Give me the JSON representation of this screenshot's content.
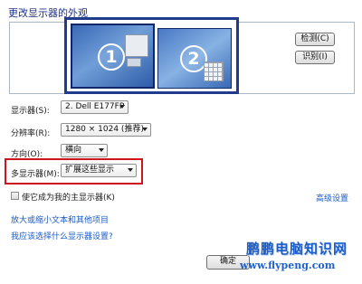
{
  "dialog": {
    "title": "更改显示器的外观"
  },
  "preview": {
    "monitor1_number": "1",
    "monitor2_number": "2"
  },
  "buttons": {
    "detect_label": "检测(C)",
    "identify_label": "识别(I)",
    "ok_label": "确定"
  },
  "form": {
    "display_label": "显示器(S):",
    "display_value": "2. Dell E177FP",
    "resolution_label": "分辨率(R):",
    "resolution_value": "1280 × 1024 (推荐)",
    "orientation_label": "方向(O):",
    "orientation_value": "横向",
    "multi_display_label": "多显示器(M):",
    "multi_display_value": "扩展这些显示"
  },
  "checkbox": {
    "label": "使它成为我的主显示器(K)",
    "checked": false
  },
  "links": {
    "advanced": "高级设置",
    "text_size": "放大或缩小文本和其他项目",
    "which_settings": "我应该选择什么显示器设置?"
  },
  "watermark": {
    "name": "鹏鹏电脑知识网",
    "url": "www.flypeng.com"
  },
  "colors": {
    "highlight": "#d0141e",
    "selection_frame": "#213c8c",
    "link": "#1c5bc2"
  }
}
